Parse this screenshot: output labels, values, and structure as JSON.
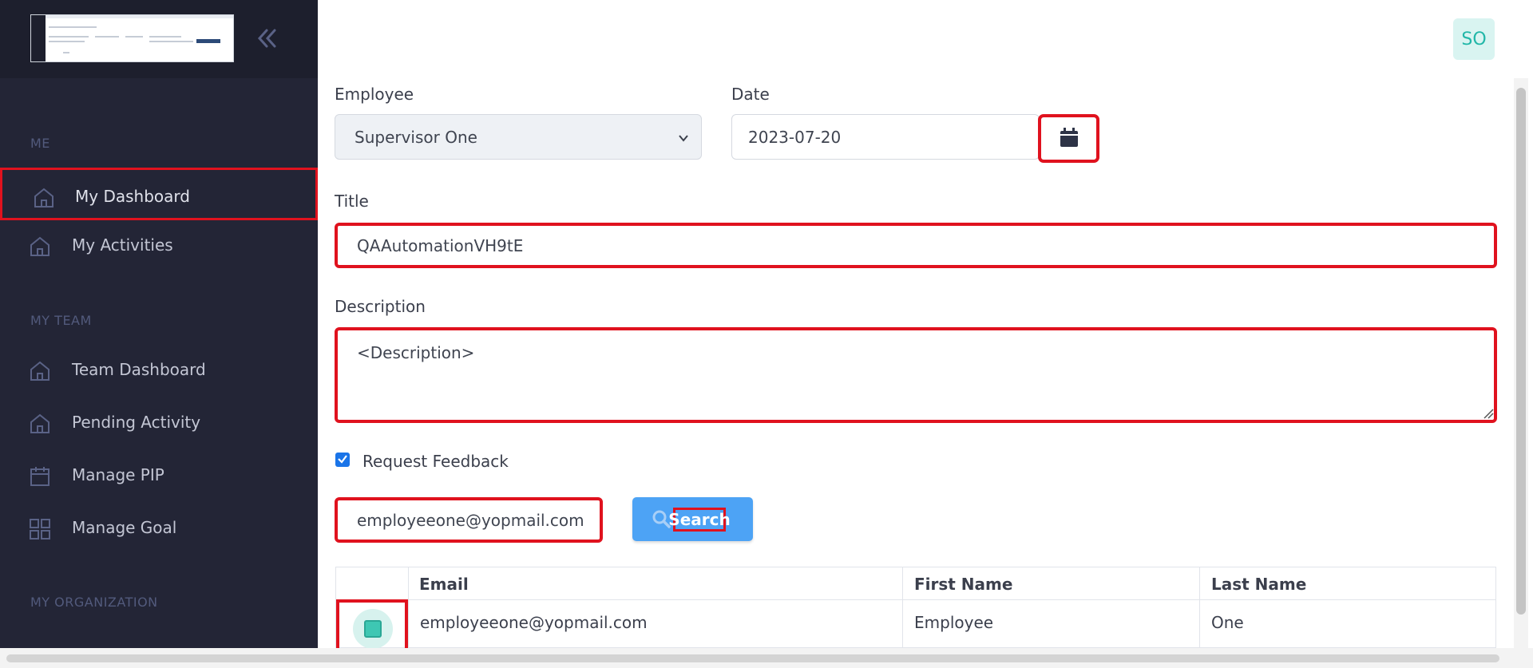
{
  "sidebar": {
    "sections": [
      "ME",
      "MY TEAM",
      "MY ORGANIZATION"
    ],
    "items": [
      {
        "label": "My Dashboard",
        "icon": "home-icon"
      },
      {
        "label": "My Activities",
        "icon": "home-icon"
      },
      {
        "label": "Team Dashboard",
        "icon": "home-icon"
      },
      {
        "label": "Pending Activity",
        "icon": "home-icon"
      },
      {
        "label": "Manage PIP",
        "icon": "calendar-icon"
      },
      {
        "label": "Manage Goal",
        "icon": "grid-icon"
      }
    ],
    "active_item": "My Dashboard",
    "collapse_icon": "double-chevron-left-icon"
  },
  "header": {
    "avatar": "SO",
    "avatar_color": "#21b7a8"
  },
  "form": {
    "employee_label": "Employee",
    "employee_value": "Supervisor One",
    "date_label": "Date",
    "date_value": "2023-07-20",
    "title_label": "Title",
    "title_value": "QAAutomationVH9tE",
    "description_label": "Description",
    "description_value": "<Description>",
    "request_feedback_label": "Request Feedback",
    "request_feedback_checked": true,
    "search_value": "employeeone@yopmail.com",
    "search_button": "Search"
  },
  "table": {
    "columns": [
      "Email",
      "First Name",
      "Last Name"
    ],
    "rows": [
      {
        "email": "employeeone@yopmail.com",
        "first_name": "Employee",
        "last_name": "One",
        "selected": true
      }
    ]
  },
  "colors": {
    "sidebar_bg": "#232536",
    "highlight": "#e0121e",
    "search_button": "#4da3f5",
    "checkbox": "#1a74e8"
  }
}
